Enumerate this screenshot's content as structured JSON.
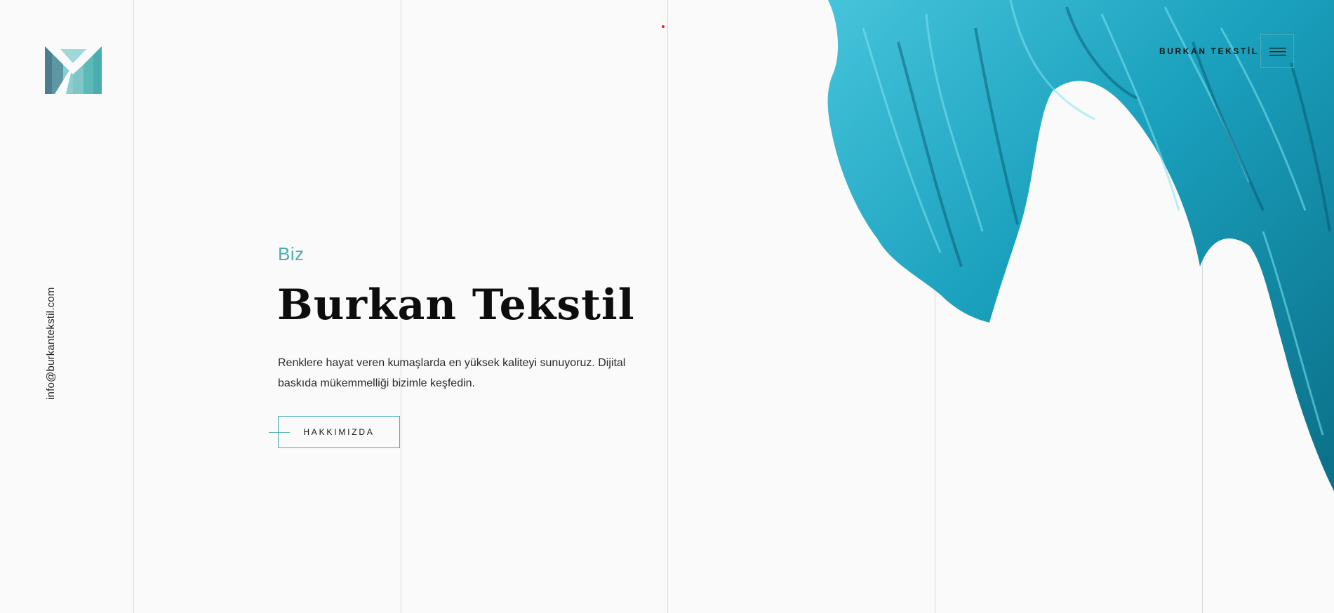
{
  "brand": {
    "logo_name": "burkan-tekstil-logo",
    "accent_color": "#4aadb0"
  },
  "sidebar": {
    "email": "info@burkantekstil.com"
  },
  "header": {
    "brand_label": "BURKAN TEKSTİL",
    "menu_icon": "hamburger-icon"
  },
  "hero": {
    "subtitle": "Biz",
    "title": "Burkan Tekstil",
    "description": "Renklere hayat veren kumaşlarda en yüksek kaliteyi sunuyoruz. Dijital baskıda mükemmelliği bizimle keşfedin.",
    "cta_label": "HAKKIMIZDA",
    "image": "teal-satin-fabric"
  }
}
